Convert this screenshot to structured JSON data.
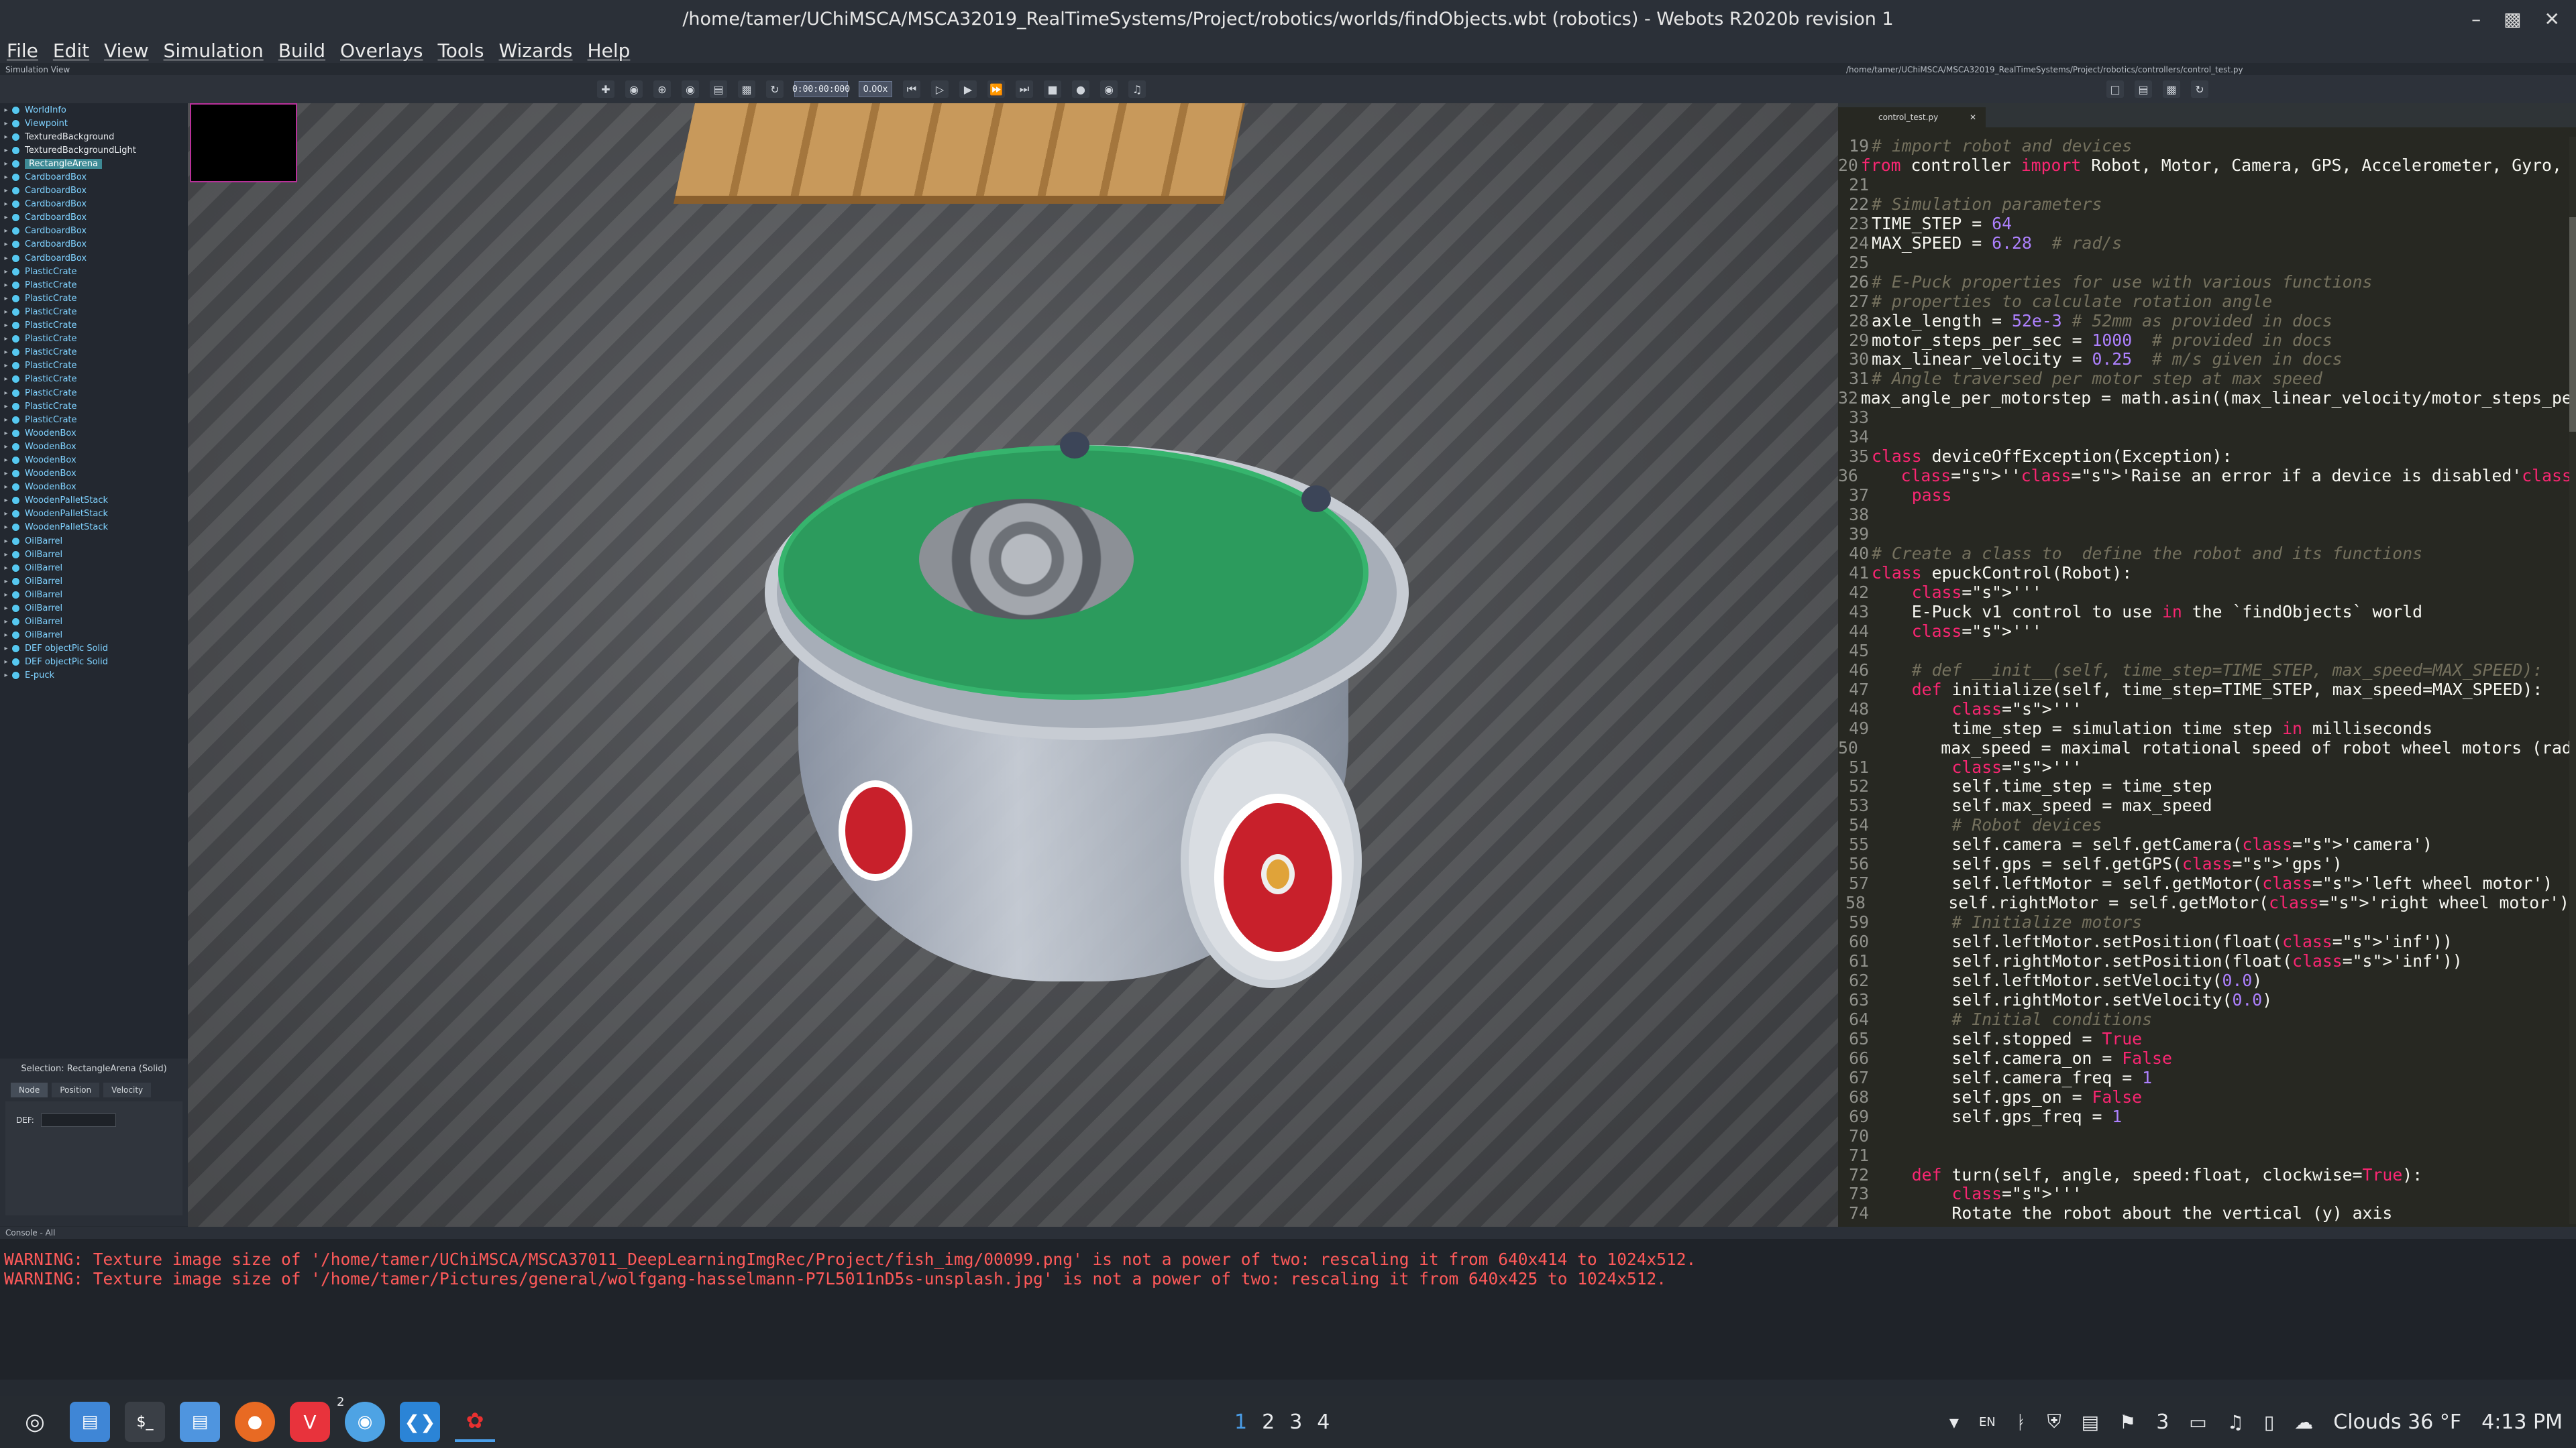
{
  "window": {
    "title": "/home/tamer/UChiMSCA/MSCA32019_RealTimeSystems/Project/robotics/worlds/findObjects.wbt (robotics) - Webots R2020b revision 1",
    "controls": [
      "minimize-icon",
      "maximize-icon",
      "close-icon"
    ]
  },
  "menu": [
    "File",
    "Edit",
    "View",
    "Simulation",
    "Build",
    "Overlays",
    "Tools",
    "Wizards",
    "Help"
  ],
  "simulation_view_label": "Simulation View",
  "editor_path": "/home/tamer/UChiMSCA/MSCA32019_RealTimeSystems/Project/robotics/controllers/control_test.py",
  "toolbar": {
    "time": "0:00:00:000",
    "speed": "0.00x",
    "icons": [
      "add-node-icon",
      "camera-icon",
      "follow-icon",
      "eye-icon",
      "open-world-icon",
      "save-world-icon",
      "reload-world-icon",
      "reset-icon",
      "step-icon",
      "play-icon",
      "fast-icon",
      "fastest-icon",
      "record-icon",
      "screenshot-icon",
      "video-icon",
      "sound-icon"
    ]
  },
  "scene_tree": [
    {
      "label": "WorldInfo",
      "style": "blue"
    },
    {
      "label": "Viewpoint",
      "style": "blue"
    },
    {
      "label": "TexturedBackground",
      "style": "lite"
    },
    {
      "label": "TexturedBackgroundLight",
      "style": "lite"
    },
    {
      "label": "RectangleArena",
      "style": "selected"
    },
    {
      "label": "CardboardBox",
      "style": "blue"
    },
    {
      "label": "CardboardBox",
      "style": "blue"
    },
    {
      "label": "CardboardBox",
      "style": "blue"
    },
    {
      "label": "CardboardBox",
      "style": "blue"
    },
    {
      "label": "CardboardBox",
      "style": "blue"
    },
    {
      "label": "CardboardBox",
      "style": "blue"
    },
    {
      "label": "CardboardBox",
      "style": "blue"
    },
    {
      "label": "PlasticCrate",
      "style": "blue"
    },
    {
      "label": "PlasticCrate",
      "style": "blue"
    },
    {
      "label": "PlasticCrate",
      "style": "blue"
    },
    {
      "label": "PlasticCrate",
      "style": "blue"
    },
    {
      "label": "PlasticCrate",
      "style": "blue"
    },
    {
      "label": "PlasticCrate",
      "style": "blue"
    },
    {
      "label": "PlasticCrate",
      "style": "blue"
    },
    {
      "label": "PlasticCrate",
      "style": "blue"
    },
    {
      "label": "PlasticCrate",
      "style": "blue"
    },
    {
      "label": "PlasticCrate",
      "style": "blue"
    },
    {
      "label": "PlasticCrate",
      "style": "blue"
    },
    {
      "label": "PlasticCrate",
      "style": "blue"
    },
    {
      "label": "WoodenBox",
      "style": "blue"
    },
    {
      "label": "WoodenBox",
      "style": "blue"
    },
    {
      "label": "WoodenBox",
      "style": "blue"
    },
    {
      "label": "WoodenBox",
      "style": "blue"
    },
    {
      "label": "WoodenBox",
      "style": "blue"
    },
    {
      "label": "WoodenPalletStack",
      "style": "blue"
    },
    {
      "label": "WoodenPalletStack",
      "style": "blue"
    },
    {
      "label": "WoodenPalletStack",
      "style": "blue"
    },
    {
      "label": "OilBarrel",
      "style": "blue"
    },
    {
      "label": "OilBarrel",
      "style": "blue"
    },
    {
      "label": "OilBarrel",
      "style": "blue"
    },
    {
      "label": "OilBarrel",
      "style": "blue"
    },
    {
      "label": "OilBarrel",
      "style": "blue"
    },
    {
      "label": "OilBarrel",
      "style": "blue"
    },
    {
      "label": "OilBarrel",
      "style": "blue"
    },
    {
      "label": "OilBarrel",
      "style": "blue"
    },
    {
      "label": "DEF objectPic Solid",
      "style": "blue"
    },
    {
      "label": "DEF objectPic Solid",
      "style": "blue"
    },
    {
      "label": "E-puck",
      "style": "blue"
    }
  ],
  "selection": {
    "header": "Selection: RectangleArena (Solid)",
    "tabs": [
      "Node",
      "Position",
      "Velocity"
    ],
    "def_label": "DEF:",
    "def_value": ""
  },
  "editor": {
    "tab": "control_test.py",
    "lines": [
      {
        "n": "19",
        "t": "# import robot and devices",
        "cls": "c"
      },
      {
        "n": "20",
        "t": "from controller import Robot, Motor, Camera, GPS, Accelerometer, Gyro, D",
        "cls": "imp"
      },
      {
        "n": "21",
        "t": "",
        "cls": ""
      },
      {
        "n": "22",
        "t": "# Simulation parameters",
        "cls": "c"
      },
      {
        "n": "23",
        "t": "TIME_STEP = 64",
        "cls": "num"
      },
      {
        "n": "24",
        "t": "MAX_SPEED = 6.28  # rad/s",
        "cls": "num"
      },
      {
        "n": "25",
        "t": "",
        "cls": ""
      },
      {
        "n": "26",
        "t": "# E-Puck properties for use with various functions",
        "cls": "c"
      },
      {
        "n": "27",
        "t": "# properties to calculate rotation angle",
        "cls": "c"
      },
      {
        "n": "28",
        "t": "axle_length = 52e-3 # 52mm as provided in docs",
        "cls": "num"
      },
      {
        "n": "29",
        "t": "motor_steps_per_sec = 1000  # provided in docs",
        "cls": "num"
      },
      {
        "n": "30",
        "t": "max_linear_velocity = 0.25  # m/s given in docs",
        "cls": "num"
      },
      {
        "n": "31",
        "t": "# Angle traversed per motor step at max speed",
        "cls": "c"
      },
      {
        "n": "32",
        "t": "max_angle_per_motorstep = math.asin((max_linear_velocity/motor_steps_per",
        "cls": ""
      },
      {
        "n": "33",
        "t": "",
        "cls": ""
      },
      {
        "n": "34",
        "t": "",
        "cls": ""
      },
      {
        "n": "35",
        "t": "class deviceOffException(Exception):",
        "cls": "kw"
      },
      {
        "n": "36",
        "t": "    '''Raise an error if a device is disabled'''",
        "cls": "s"
      },
      {
        "n": "37",
        "t": "    pass",
        "cls": "kw"
      },
      {
        "n": "38",
        "t": "",
        "cls": ""
      },
      {
        "n": "39",
        "t": "",
        "cls": ""
      },
      {
        "n": "40",
        "t": "# Create a class to  define the robot and its functions",
        "cls": "c"
      },
      {
        "n": "41",
        "t": "class epuckControl(Robot):",
        "cls": "kw"
      },
      {
        "n": "42",
        "t": "    '''",
        "cls": "s"
      },
      {
        "n": "43",
        "t": "    E-Puck v1 control to use in the `findObjects` world",
        "cls": ""
      },
      {
        "n": "44",
        "t": "    '''",
        "cls": "s"
      },
      {
        "n": "45",
        "t": "",
        "cls": ""
      },
      {
        "n": "46",
        "t": "    # def __init__(self, time_step=TIME_STEP, max_speed=MAX_SPEED):",
        "cls": "c"
      },
      {
        "n": "47",
        "t": "    def initialize(self, time_step=TIME_STEP, max_speed=MAX_SPEED):",
        "cls": "kw"
      },
      {
        "n": "48",
        "t": "        '''",
        "cls": "s"
      },
      {
        "n": "49",
        "t": "        time_step = simulation time step in milliseconds",
        "cls": ""
      },
      {
        "n": "50",
        "t": "        max_speed = maximal rotational speed of robot wheel motors (rad/s)",
        "cls": ""
      },
      {
        "n": "51",
        "t": "        '''",
        "cls": "s"
      },
      {
        "n": "52",
        "t": "        self.time_step = time_step",
        "cls": ""
      },
      {
        "n": "53",
        "t": "        self.max_speed = max_speed",
        "cls": ""
      },
      {
        "n": "54",
        "t": "        # Robot devices",
        "cls": "c"
      },
      {
        "n": "55",
        "t": "        self.camera = self.getCamera('camera')",
        "cls": ""
      },
      {
        "n": "56",
        "t": "        self.gps = self.getGPS('gps')",
        "cls": ""
      },
      {
        "n": "57",
        "t": "        self.leftMotor = self.getMotor('left wheel motor')",
        "cls": ""
      },
      {
        "n": "58",
        "t": "        self.rightMotor = self.getMotor('right wheel motor')",
        "cls": ""
      },
      {
        "n": "59",
        "t": "        # Initialize motors",
        "cls": "c"
      },
      {
        "n": "60",
        "t": "        self.leftMotor.setPosition(float('inf'))",
        "cls": ""
      },
      {
        "n": "61",
        "t": "        self.rightMotor.setPosition(float('inf'))",
        "cls": ""
      },
      {
        "n": "62",
        "t": "        self.leftMotor.setVelocity(0.0)",
        "cls": ""
      },
      {
        "n": "63",
        "t": "        self.rightMotor.setVelocity(0.0)",
        "cls": ""
      },
      {
        "n": "64",
        "t": "        # Initial conditions",
        "cls": "c"
      },
      {
        "n": "65",
        "t": "        self.stopped = True",
        "cls": ""
      },
      {
        "n": "66",
        "t": "        self.camera_on = False",
        "cls": ""
      },
      {
        "n": "67",
        "t": "        self.camera_freq = 1",
        "cls": ""
      },
      {
        "n": "68",
        "t": "        self.gps_on = False",
        "cls": ""
      },
      {
        "n": "69",
        "t": "        self.gps_freq = 1",
        "cls": ""
      },
      {
        "n": "70",
        "t": "",
        "cls": ""
      },
      {
        "n": "71",
        "t": "",
        "cls": ""
      },
      {
        "n": "72",
        "t": "    def turn(self, angle, speed:float, clockwise=True):",
        "cls": "kw"
      },
      {
        "n": "73",
        "t": "        '''",
        "cls": "s"
      },
      {
        "n": "74",
        "t": "        Rotate the robot about the vertical (y) axis",
        "cls": ""
      }
    ]
  },
  "console": {
    "label": "Console - All",
    "messages": [
      "WARNING: Texture image size of '/home/tamer/UChiMSCA/MSCA37011_DeepLearningImgRec/Project/fish_img/00099.png' is not a power of two: rescaling it from 640x414 to 1024x512.",
      "WARNING: Texture image size of '/home/tamer/Pictures/general/wolfgang-hasselmann-P7L5011nD5s-unsplash.jpg' is not a power of two: rescaling it from 640x425 to 1024x512."
    ]
  },
  "taskbar": {
    "apps": [
      "menu-icon",
      "files-icon",
      "terminal-icon",
      "folder-icon",
      "firefox-icon",
      "vivaldi-icon",
      "chrome-icon",
      "vscode-icon",
      "webots-icon"
    ],
    "chrome_badge": "2",
    "workspaces": [
      "1",
      "2",
      "3",
      "4"
    ],
    "current_workspace": "1",
    "lang": "EN",
    "notif_count": "3",
    "weather": "Clouds 36 °F",
    "clock": "4:13 PM"
  },
  "colors": {
    "accent": "#4a9ee8",
    "warning": "#ff5a5a",
    "selection": "#3e8a95"
  }
}
